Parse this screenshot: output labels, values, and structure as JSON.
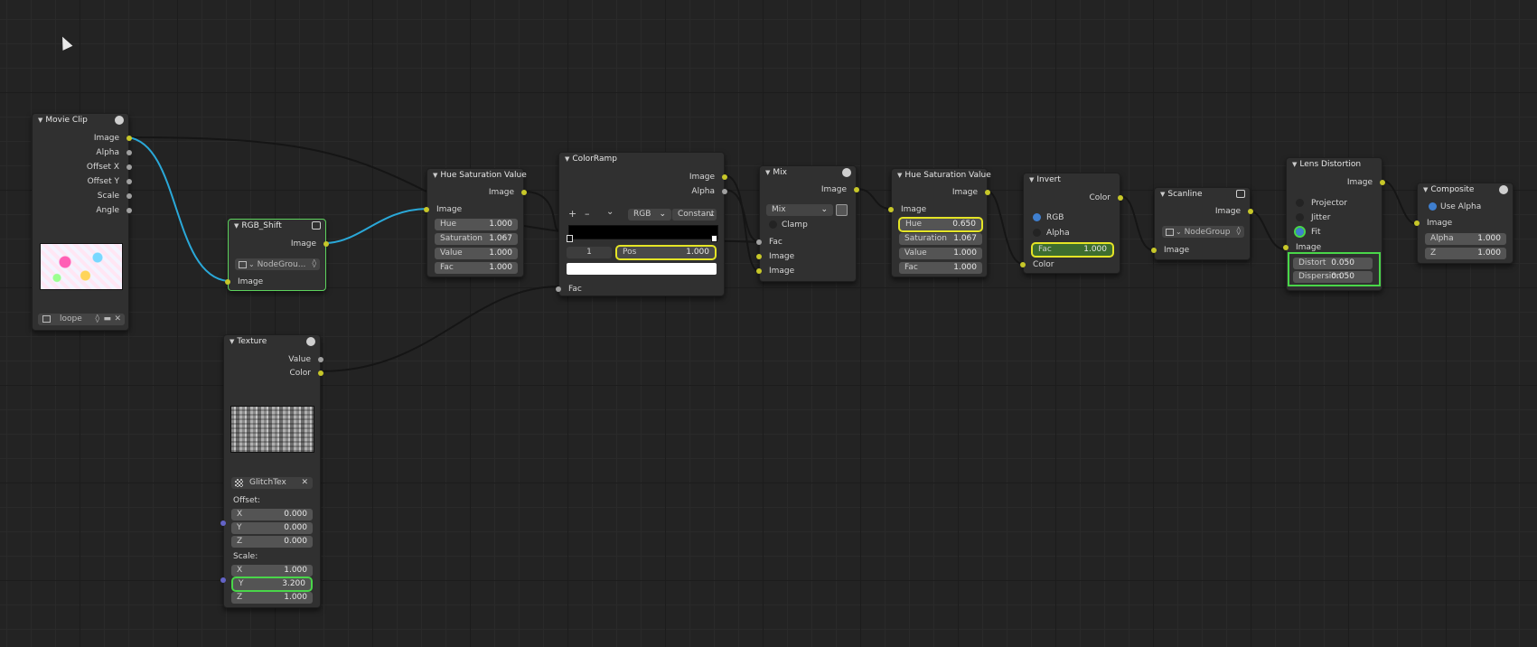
{
  "movie_clip": {
    "title": "Movie Clip",
    "outputs": [
      "Image",
      "Alpha",
      "Offset X",
      "Offset Y",
      "Scale",
      "Angle"
    ],
    "clip_name": "loope"
  },
  "rgb_shift": {
    "title": "RGB_Shift",
    "output": "Image",
    "group": "NodeGrou...",
    "input": "Image"
  },
  "texture": {
    "title": "Texture",
    "outputs": [
      "Value",
      "Color"
    ],
    "tex_name": "GlitchTex",
    "offset_label": "Offset:",
    "offset": [
      {
        "l": "X",
        "v": "0.000"
      },
      {
        "l": "Y",
        "v": "0.000"
      },
      {
        "l": "Z",
        "v": "0.000"
      }
    ],
    "scale_label": "Scale:",
    "scale": [
      {
        "l": "X",
        "v": "1.000"
      },
      {
        "l": "Y",
        "v": "3.200"
      },
      {
        "l": "Z",
        "v": "1.000"
      }
    ]
  },
  "hsv1": {
    "title": "Hue Saturation Value",
    "output": "Image",
    "input": "Image",
    "fields": [
      {
        "l": "Hue",
        "v": "1.000"
      },
      {
        "l": "Saturation",
        "v": "1.067"
      },
      {
        "l": "Value",
        "v": "1.000"
      },
      {
        "l": "Fac",
        "v": "1.000"
      }
    ]
  },
  "colorramp": {
    "title": "ColorRamp",
    "outputs": [
      "Image",
      "Alpha"
    ],
    "color_mode": "RGB",
    "interp": "Constant",
    "index": "1",
    "pos_label": "Pos",
    "pos_value": "1.000",
    "input": "Fac",
    "add": "+",
    "remove": "–",
    "menu": "⌄"
  },
  "mix": {
    "title": "Mix",
    "output": "Image",
    "blend": "Mix",
    "clamp": "Clamp",
    "inputs": [
      "Fac",
      "Image",
      "Image"
    ]
  },
  "hsv2": {
    "title": "Hue Saturation Value",
    "output": "Image",
    "input": "Image",
    "fields": [
      {
        "l": "Hue",
        "v": "0.650"
      },
      {
        "l": "Saturation",
        "v": "1.067"
      },
      {
        "l": "Value",
        "v": "1.000"
      },
      {
        "l": "Fac",
        "v": "1.000"
      }
    ]
  },
  "invert": {
    "title": "Invert",
    "output": "Color",
    "rgb": "RGB",
    "alpha": "Alpha",
    "fac_label": "Fac",
    "fac_value": "1.000",
    "input": "Color"
  },
  "scanline": {
    "title": "Scanline",
    "output": "Image",
    "group": "NodeGroup",
    "input": "Image"
  },
  "lens": {
    "title": "Lens Distortion",
    "output": "Image",
    "options": [
      "Projector",
      "Jitter",
      "Fit"
    ],
    "input": "Image",
    "fields": [
      {
        "l": "Distort",
        "v": "0.050"
      },
      {
        "l": "Dispersion",
        "v": "0.050"
      }
    ]
  },
  "composite": {
    "title": "Composite",
    "use_alpha": "Use Alpha",
    "input": "Image",
    "fields": [
      {
        "l": "Alpha",
        "v": "1.000"
      },
      {
        "l": "Z",
        "v": "1.000"
      }
    ]
  },
  "colors": {
    "socket_yellow": "#c7c729",
    "socket_gray": "#a0a0a0",
    "socket_purple": "#6363c7",
    "highlight_yellow": "#e4e426",
    "highlight_green": "#49d649",
    "link_blue": "#2aa8d8"
  }
}
